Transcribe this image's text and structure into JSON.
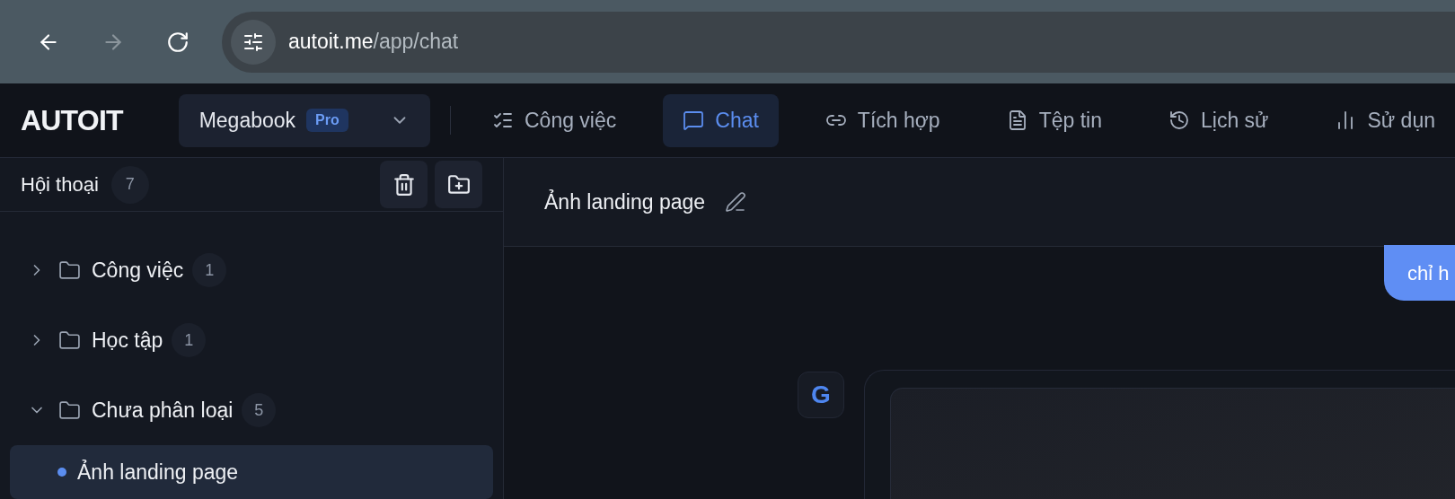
{
  "browser": {
    "host": "autoit.me",
    "path": "/app/chat",
    "nav_buttons": [
      {
        "disabled": false
      },
      {
        "disabled": true
      },
      {
        "disabled": false
      }
    ]
  },
  "app_bar": {
    "logo": "AUTOIT",
    "workspace": {
      "name": "Megabook",
      "plan": "Pro"
    },
    "tabs": [
      {
        "label": "Công việc",
        "selected": false
      },
      {
        "label": "Chat",
        "selected": true
      },
      {
        "label": "Tích hợp",
        "selected": false
      },
      {
        "label": "Tệp tin",
        "selected": false
      },
      {
        "label": "Lịch sử",
        "selected": false
      },
      {
        "label": "Sử dụn",
        "selected": false
      }
    ]
  },
  "sidebar": {
    "title": "Hội thoại",
    "count": "7",
    "folders": [
      {
        "name": "Công việc",
        "count": "1",
        "expanded": false
      },
      {
        "name": "Học tập",
        "count": "1",
        "expanded": false
      },
      {
        "name": "Chưa phân loại",
        "count": "5",
        "expanded": true,
        "children": [
          {
            "name": "Ảnh landing page",
            "selected": true
          }
        ]
      }
    ]
  },
  "chat": {
    "title": "Ảnh landing page",
    "messages": [
      {
        "kind": "user",
        "text": "chỉ h"
      },
      {
        "kind": "assistant",
        "avatar": "G"
      }
    ]
  }
}
